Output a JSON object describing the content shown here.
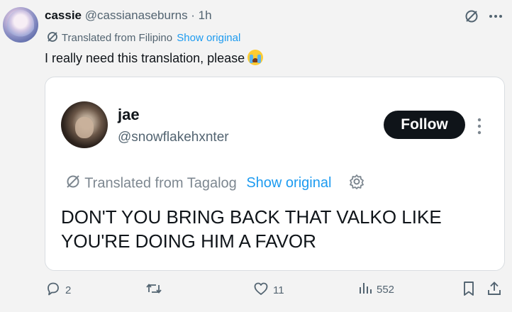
{
  "tweet": {
    "author_name": "cassie",
    "author_handle": "@cassianaseburns",
    "time": " · 1h",
    "translation_note": "Translated from Filipino",
    "show_original": "Show original",
    "text": "I really need this translation, please"
  },
  "quoted": {
    "name": "jae",
    "handle": "@snowflakehxnter",
    "follow_label": "Follow",
    "translation_note": "Translated from Tagalog",
    "show_original": "Show original",
    "text": "DON'T YOU BRING BACK THAT VALKO LIKE YOU'RE DOING HIM A FAVOR"
  },
  "actions": {
    "replies": "2",
    "reposts": "",
    "likes": "11",
    "views": "552"
  },
  "icons": {
    "translate": "translate-icon",
    "more": "more-icon",
    "settings": "gear-icon",
    "reply": "reply-icon",
    "repost": "repost-icon",
    "like": "heart-icon",
    "views": "views-icon",
    "bookmark": "bookmark-icon",
    "share": "share-icon"
  },
  "colors": {
    "link": "#1d9bf0",
    "follow_bg": "#0f1419",
    "muted": "#536471"
  }
}
